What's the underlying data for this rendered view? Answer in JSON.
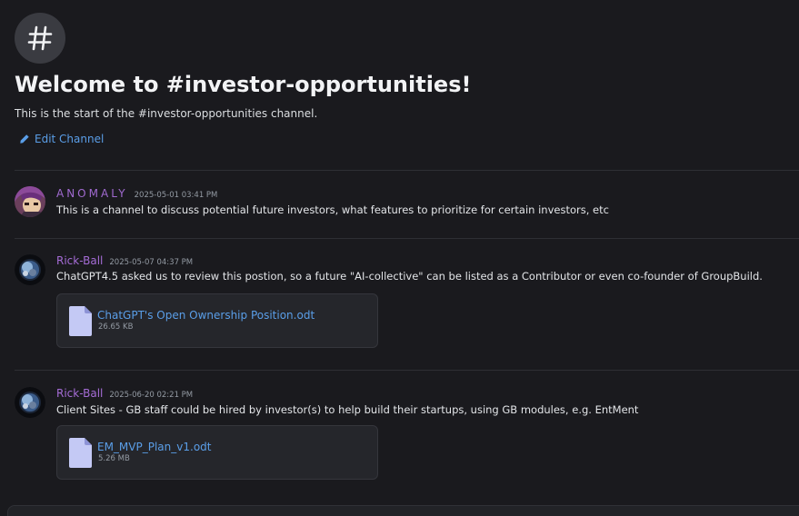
{
  "channel": {
    "welcome_title": "Welcome to #investor-opportunities!",
    "welcome_subtitle": "This is the start of the #investor-opportunities channel.",
    "edit_label": "Edit Channel",
    "hash_icon": "hash-icon"
  },
  "messages": [
    {
      "author": "ANOMALY",
      "timestamp": "2025-05-01 03:41 PM",
      "text": "This is a channel to discuss potential future investors, what features to prioritize for certain investors, etc"
    },
    {
      "author": "Rick-Ball",
      "timestamp": "2025-05-07 04:37 PM",
      "text": "ChatGPT4.5 asked us to review this postion, so a future \"AI-collective\" can be listed as a Contributor or even co-founder of GroupBuild.",
      "attachment": {
        "name": "ChatGPT's Open Ownership Position.odt",
        "size": "26.65 KB"
      }
    },
    {
      "author": "Rick-Ball",
      "timestamp": "2025-06-20 02:21 PM",
      "text": "Client Sites - GB staff could be hired by investor(s) to help build their startups, using GB modules, e.g. EntMent",
      "attachment": {
        "name": "EM_MVP_Plan_v1.odt",
        "size": "5.26 MB"
      }
    }
  ],
  "colors": {
    "background": "#1a1a1e",
    "author": "#a56cd6",
    "link": "#5a9ee8",
    "file_icon": "#c4c9f5"
  }
}
